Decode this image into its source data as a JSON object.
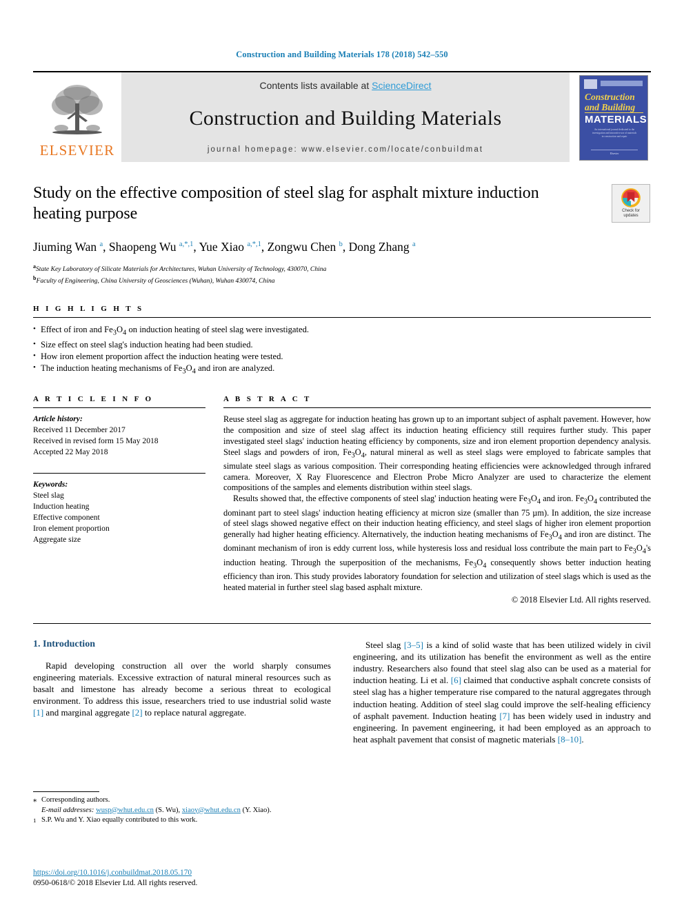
{
  "running_head": "Construction and Building Materials 178 (2018) 542–550",
  "masthead": {
    "publisher_name": "ELSEVIER",
    "contents_prefix": "Contents lists available at ",
    "contents_link": "ScienceDirect",
    "journal_title": "Construction and Building Materials",
    "homepage": "journal homepage: www.elsevier.com/locate/conbuildmat",
    "cover": {
      "line1": "Construction",
      "line2": "and Building",
      "line3": "MATERIALS",
      "blurb": "An international journal dedicated to the investigation and innovative use of materials in construction and repair",
      "footer": "Elsevier"
    }
  },
  "crossmark": {
    "label_line1": "Check for",
    "label_line2": "updates"
  },
  "article": {
    "title": "Study on the effective composition of steel slag for asphalt mixture induction heating purpose",
    "authors_html": "Jiuming Wan <sup>a</sup>, Shaopeng Wu <sup>a,*,1</sup>, Yue Xiao <sup>a,*,1</sup>, Zongwu Chen <sup>b</sup>, Dong Zhang <sup>a</sup>",
    "affiliations": [
      {
        "marker": "a",
        "text": "State Key Laboratory of Silicate Materials for Architectures, Wuhan University of Technology, 430070, China"
      },
      {
        "marker": "b",
        "text": "Faculty of Engineering, China University of Geosciences (Wuhan), Wuhan 430074, China"
      }
    ]
  },
  "highlights": {
    "label": "H I G H L I G H T S",
    "items_html": [
      "Effect of iron and Fe<sub>3</sub>O<sub>4</sub> on induction heating of steel slag were investigated.",
      "Size effect on steel slag's induction heating had been studied.",
      "How iron element proportion affect the induction heating were tested.",
      "The induction heating mechanisms of Fe<sub>3</sub>O<sub>4</sub> and iron are analyzed."
    ]
  },
  "article_info": {
    "label": "A R T I C L E   I N F O",
    "history_label": "Article history:",
    "history": [
      "Received 11 December 2017",
      "Received in revised form 15 May 2018",
      "Accepted 22 May 2018"
    ],
    "keywords_label": "Keywords:",
    "keywords": [
      "Steel slag",
      "Induction heating",
      "Effective component",
      "Iron element proportion",
      "Aggregate size"
    ]
  },
  "abstract": {
    "label": "A B S T R A C T",
    "paragraph1_html": "Reuse steel slag as aggregate for induction heating has grown up to an important subject of asphalt pavement. However, how the composition and size of steel slag affect its induction heating efficiency still requires further study. This paper investigated steel slags' induction heating efficiency by components, size and iron element proportion dependency analysis. Steel slags and powders of iron, Fe<sub>3</sub>O<sub>4</sub>, natural mineral as well as steel slags were employed to fabricate samples that simulate steel slags as various composition. Their corresponding heating efficiencies were acknowledged through infrared camera. Moreover, X Ray Fluorescence and Electron Probe Micro Analyzer are used to characterize the element compositions of the samples and elements distribution within steel slags.",
    "paragraph2_html": "Results showed that, the effective components of steel slag' induction heating were Fe<sub>3</sub>O<sub>4</sub> and iron. Fe<sub>3</sub>O<sub>4</sub> contributed the dominant part to steel slags' induction heating efficiency at micron size (smaller than 75 µm). In addition, the size increase of steel slags showed negative effect on their induction heating efficiency, and steel slags of higher iron element proportion generally had higher heating efficiency. Alternatively, the induction heating mechanisms of Fe<sub>3</sub>O<sub>4</sub> and iron are distinct. The dominant mechanism of iron is eddy current loss, while hysteresis loss and residual loss contribute the main part to Fe<sub>3</sub>O<sub>4</sub>'s induction heating. Through the superposition of the mechanisms, Fe<sub>3</sub>O<sub>4</sub> consequently shows better induction heating efficiency than iron. This study provides laboratory foundation for selection and utilization of steel slags which is used as the heated material in further steel slag based asphalt mixture.",
    "copyright": "© 2018 Elsevier Ltd. All rights reserved."
  },
  "body": {
    "section_heading": "1. Introduction",
    "left_paragraph_html": "Rapid developing construction all over the world sharply consumes engineering materials. Excessive extraction of natural mineral resources such as basalt and limestone has already become a serious threat to ecological environment. To address this issue, researchers tried to use industrial solid waste <span class=\"ref\">[1]</span> and marginal aggregate <span class=\"ref\">[2]</span> to replace natural aggregate.",
    "right_paragraph_html": "Steel slag <span class=\"ref\">[3–5]</span> is a kind of solid waste that has been utilized widely in civil engineering, and its utilization has benefit the environment as well as the entire industry. Researchers also found that steel slag also can be used as a material for induction heating. Li et al. <span class=\"ref\">[6]</span> claimed that conductive asphalt concrete consists of steel slag has a higher temperature rise compared to the natural aggregates through induction heating. Addition of steel slag could improve the self-healing efficiency of asphalt pavement. Induction heating <span class=\"ref\">[7]</span> has been widely used in industry and engineering. In pavement engineering, it had been employed as an approach to heat asphalt pavement that consist of magnetic materials <span class=\"ref\">[8–10]</span>."
  },
  "footnotes": {
    "corresponding_marker": "⁎",
    "corresponding_text": "Corresponding authors.",
    "email_label": "E-mail addresses:",
    "email1": "wusp@whut.edu.cn",
    "email1_owner": "(S. Wu),",
    "email2": "xiaoy@whut.edu.cn",
    "email2_owner": "(Y. Xiao).",
    "equal_marker": "1",
    "equal_text": "S.P. Wu and Y. Xiao equally contributed to this work."
  },
  "doi": {
    "url": "https://doi.org/10.1016/j.conbuildmat.2018.05.170",
    "issn_line": "0950-0618/© 2018 Elsevier Ltd. All rights reserved."
  },
  "colors": {
    "link_blue": "#1a7fb5",
    "sciencedirect_blue": "#2e9bd6",
    "elsevier_orange": "#E87722",
    "heading_blue": "#1a4f7a",
    "cover_blue": "#3b4fa4",
    "cover_yellow": "#f3d24a"
  }
}
